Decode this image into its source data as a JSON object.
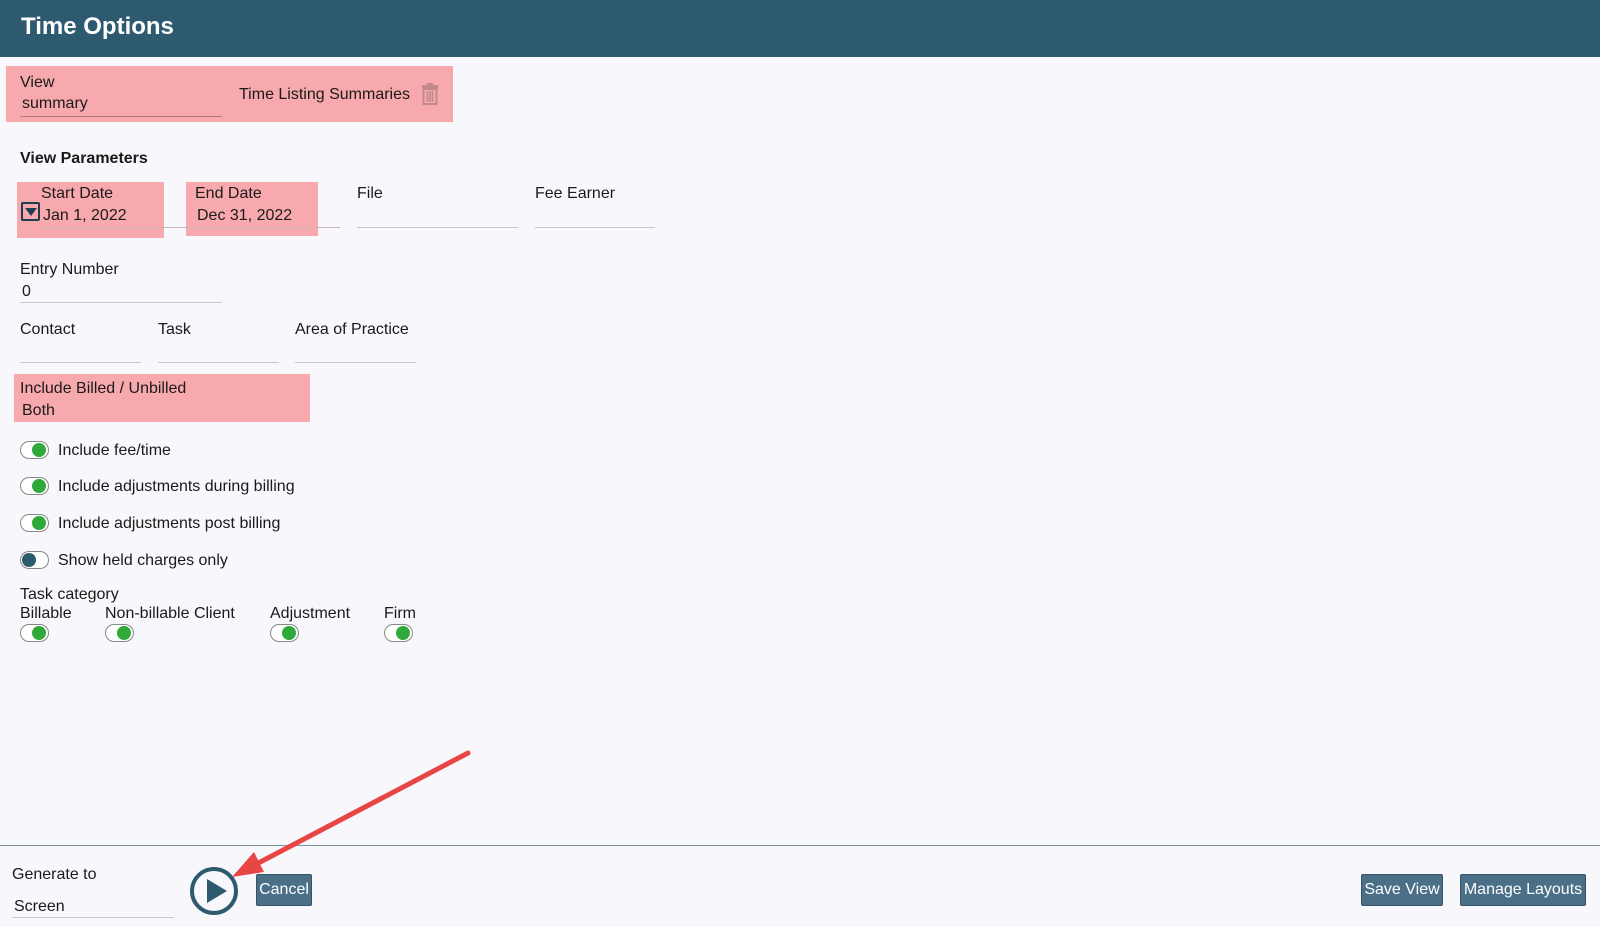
{
  "header": {
    "title": "Time Options"
  },
  "view": {
    "label": "View",
    "value": "summary",
    "layout_name": "Time Listing Summaries"
  },
  "params": {
    "heading": "View Parameters",
    "start_date": {
      "label": "Start Date",
      "value": "Jan 1, 2022"
    },
    "end_date": {
      "label": "End Date",
      "value": "Dec 31, 2022"
    },
    "file": {
      "label": "File",
      "value": ""
    },
    "fee_earner": {
      "label": "Fee Earner",
      "value": ""
    },
    "entry_number": {
      "label": "Entry Number",
      "value": "0"
    },
    "contact": {
      "label": "Contact",
      "value": ""
    },
    "task": {
      "label": "Task",
      "value": ""
    },
    "area_of_practice": {
      "label": "Area of Practice",
      "value": ""
    },
    "billed": {
      "label": "Include Billed / Unbilled",
      "value": "Both"
    }
  },
  "toggles": [
    {
      "label": "Include fee/time",
      "on": true
    },
    {
      "label": "Include adjustments during billing",
      "on": true
    },
    {
      "label": "Include adjustments post billing",
      "on": true
    },
    {
      "label": "Show held charges only",
      "on": false
    }
  ],
  "task_category": {
    "label": "Task category",
    "items": [
      {
        "label": "Billable",
        "on": true
      },
      {
        "label": "Non-billable Client",
        "on": true
      },
      {
        "label": "Adjustment",
        "on": true
      },
      {
        "label": "Firm",
        "on": true
      }
    ]
  },
  "footer": {
    "generate_to_label": "Generate to",
    "generate_to_value": "Screen",
    "cancel": "Cancel",
    "save_view": "Save View",
    "manage_layouts": "Manage Layouts"
  },
  "colors": {
    "header": "#2e5a70",
    "highlight": "#f8a9ad",
    "toggle_on": "#2faa3a",
    "toggle_off": "#2e5a70",
    "button": "#4a6f86",
    "annotation_arrow": "#e84545"
  }
}
